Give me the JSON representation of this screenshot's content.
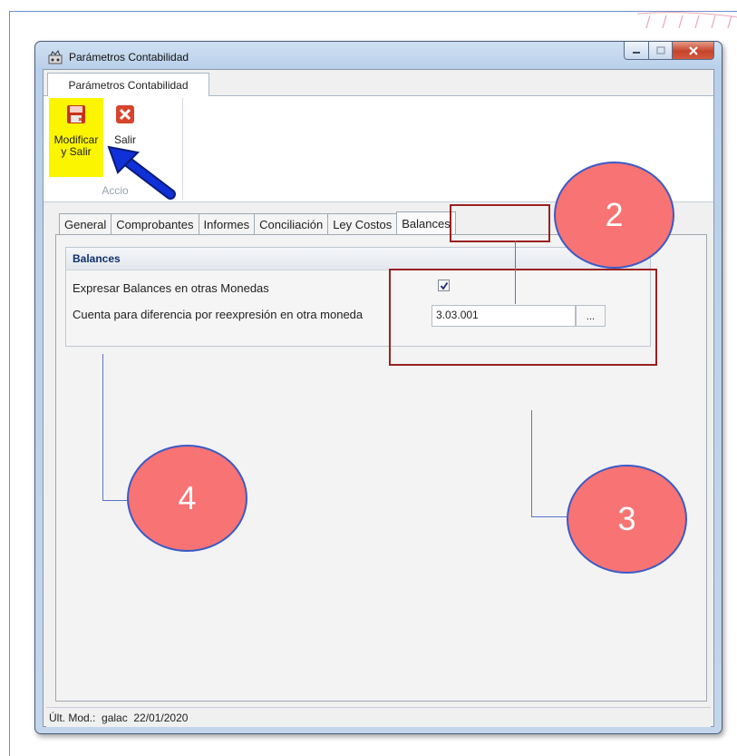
{
  "window": {
    "title": "Parámetros Contabilidad",
    "icon": "app-settings-icon",
    "controls": [
      "minimize-icon",
      "maximize-icon",
      "close-icon"
    ]
  },
  "ribbon": {
    "tab_label": "Parámetros Contabilidad",
    "save_button": {
      "label_line1": "Modificar",
      "label_line2": "y Salir",
      "icon": "floppy-disk-icon",
      "highlight_color": "#fbf600"
    },
    "exit_button": {
      "label": "Salir",
      "icon": "red-x-icon"
    },
    "group_label": "Accio"
  },
  "tabs": [
    {
      "label": "General",
      "active": false
    },
    {
      "label": "Comprobantes",
      "active": false
    },
    {
      "label": "Informes",
      "active": false
    },
    {
      "label": "Conciliación",
      "active": false
    },
    {
      "label": "Ley Costos",
      "active": false
    },
    {
      "label": "Balances",
      "active": true
    }
  ],
  "balances": {
    "header": "Balances",
    "express_label": "Expresar Balances en otras Monedas",
    "express_checked": true,
    "account_label": "Cuenta para diferencia por reexpresión en otra moneda",
    "account_value": "3.03.001",
    "browse_label": "..."
  },
  "status": {
    "text": "Últ. Mod.:  galac  22/01/2020"
  },
  "annotations": {
    "marker_2": "2",
    "marker_3": "3",
    "marker_4": "4",
    "circle_color": "#f87373",
    "rect_color": "#9a2020",
    "arrow_color": "#1030d8"
  }
}
